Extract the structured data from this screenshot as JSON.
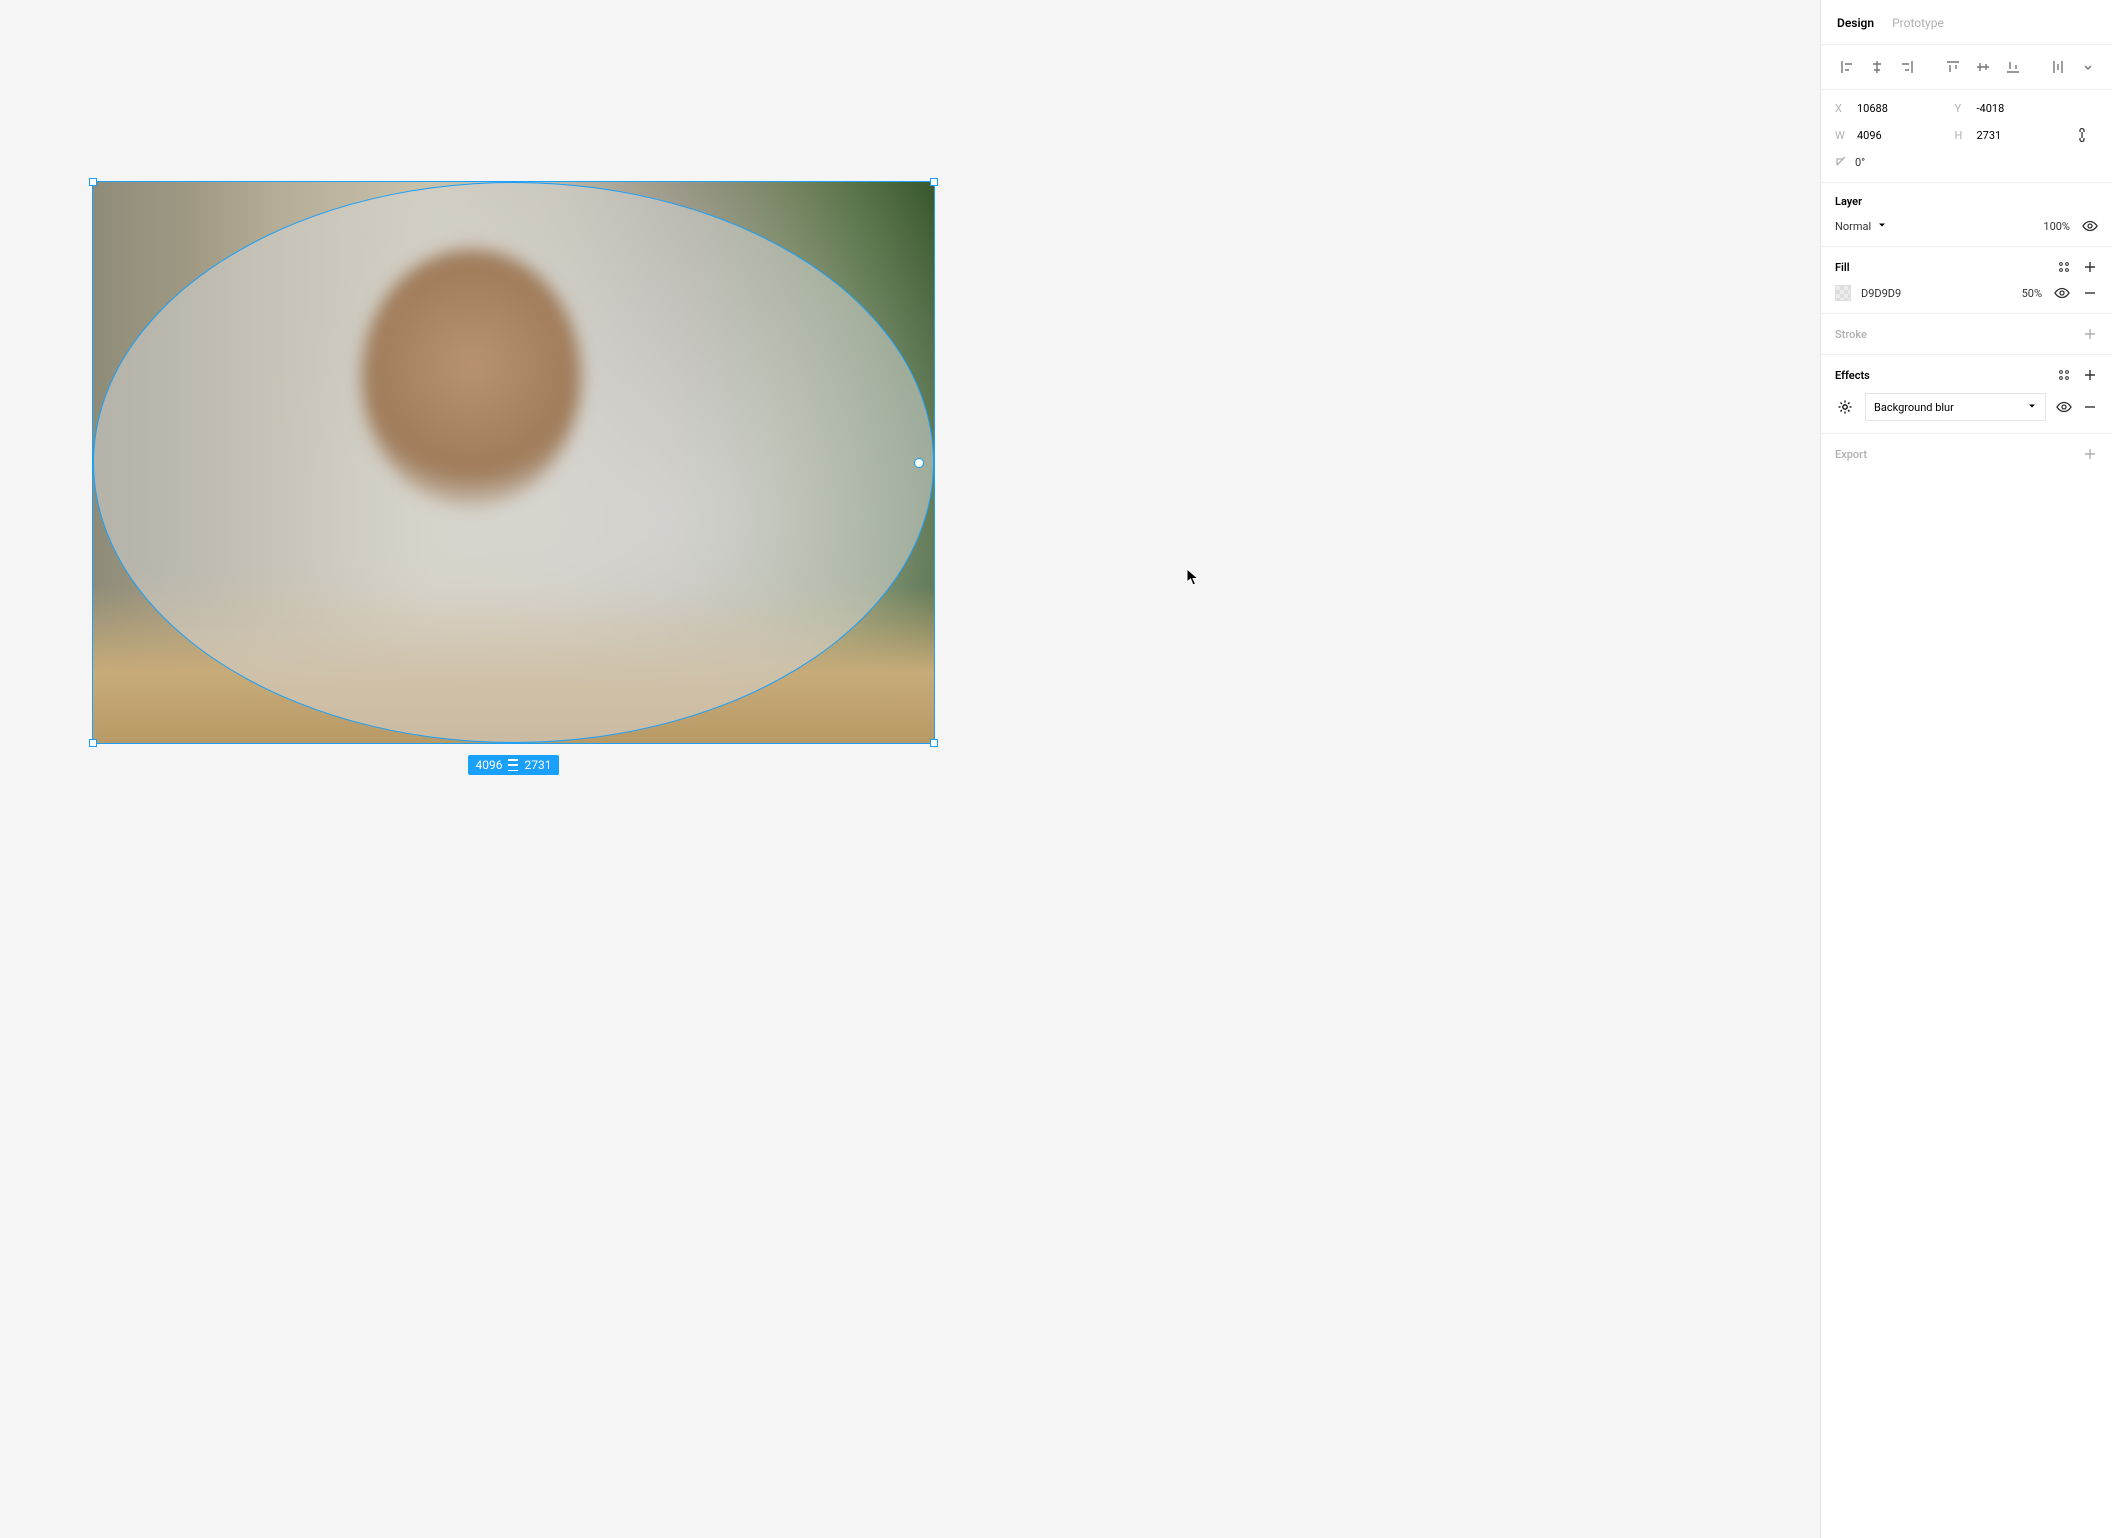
{
  "tabs": {
    "design": "Design",
    "prototype": "Prototype",
    "active": "design"
  },
  "transform": {
    "x_label": "X",
    "x_value": "10688",
    "y_label": "Y",
    "y_value": "-4018",
    "w_label": "W",
    "w_value": "4096",
    "h_label": "H",
    "h_value": "2731",
    "rotation": "0°"
  },
  "layer": {
    "title": "Layer",
    "blend_mode": "Normal",
    "opacity": "100%"
  },
  "fill": {
    "title": "Fill",
    "hex": "D9D9D9",
    "opacity": "50%"
  },
  "stroke": {
    "title": "Stroke"
  },
  "effects": {
    "title": "Effects",
    "items": [
      {
        "name": "Background blur"
      }
    ]
  },
  "export": {
    "title": "Export"
  },
  "canvas": {
    "selection_width": "4096",
    "selection_height": "2731"
  }
}
